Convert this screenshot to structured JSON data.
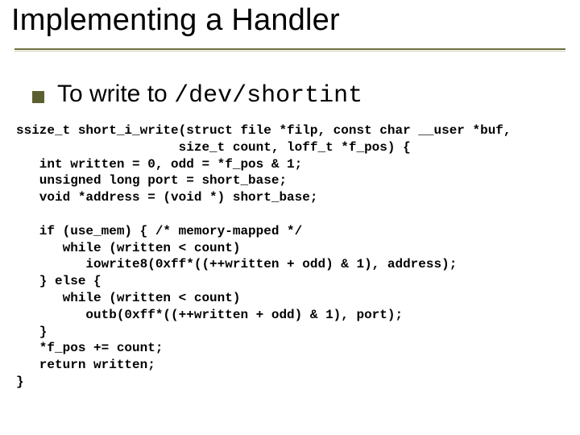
{
  "title": "Implementing a Handler",
  "bullet": {
    "prefix": "To write to ",
    "code": "/dev/shortint"
  },
  "code": "ssize_t short_i_write(struct file *filp, const char __user *buf,\n                     size_t count, loff_t *f_pos) {\n   int written = 0, odd = *f_pos & 1;\n   unsigned long port = short_base;\n   void *address = (void *) short_base;\n\n   if (use_mem) { /* memory-mapped */\n      while (written < count)\n         iowrite8(0xff*((++written + odd) & 1), address);\n   } else {\n      while (written < count)\n         outb(0xff*((++written + odd) & 1), port);\n   }\n   *f_pos += count;\n   return written;\n}"
}
